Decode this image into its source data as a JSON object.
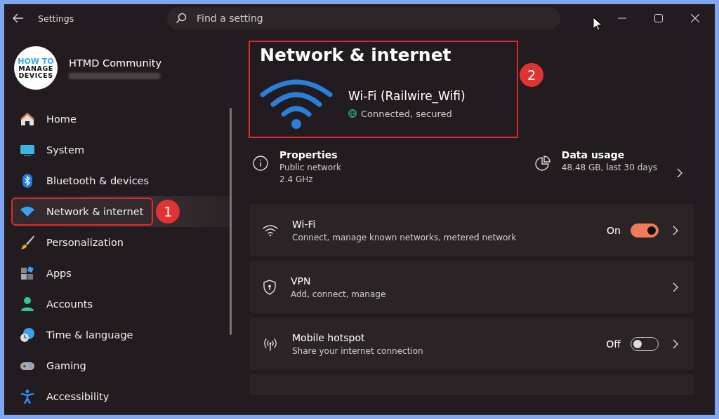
{
  "window": {
    "title": "Settings"
  },
  "search": {
    "placeholder": "Find a setting"
  },
  "account": {
    "logo_lines": [
      "HOW TO",
      "MANAGE",
      "DEVICES"
    ],
    "name": "HTMD Community"
  },
  "nav": [
    {
      "label": "Home",
      "selected": false
    },
    {
      "label": "System",
      "selected": false
    },
    {
      "label": "Bluetooth & devices",
      "selected": false
    },
    {
      "label": "Network & internet",
      "selected": true,
      "callout": "1"
    },
    {
      "label": "Personalization",
      "selected": false
    },
    {
      "label": "Apps",
      "selected": false
    },
    {
      "label": "Accounts",
      "selected": false
    },
    {
      "label": "Time & language",
      "selected": false
    },
    {
      "label": "Gaming",
      "selected": false
    },
    {
      "label": "Accessibility",
      "selected": false
    }
  ],
  "header": {
    "title": "Network & internet",
    "connection": "Wi-Fi (Railwire_Wifi)",
    "status": "Connected, secured",
    "callout": "2"
  },
  "properties": {
    "title": "Properties",
    "lines": [
      "Public network",
      "2.4 GHz"
    ]
  },
  "data_usage": {
    "title": "Data usage",
    "detail": "48.48 GB, last 30 days"
  },
  "settings": [
    {
      "kind": "wifi",
      "title": "Wi-Fi",
      "subtitle": "Connect, manage known networks, metered network",
      "state_label": "On",
      "on": true
    },
    {
      "kind": "vpn",
      "title": "VPN",
      "subtitle": "Add, connect, manage"
    },
    {
      "kind": "hotspot",
      "title": "Mobile hotspot",
      "subtitle": "Share your internet connection",
      "state_label": "Off",
      "on": false
    },
    {
      "kind": "empty"
    }
  ]
}
